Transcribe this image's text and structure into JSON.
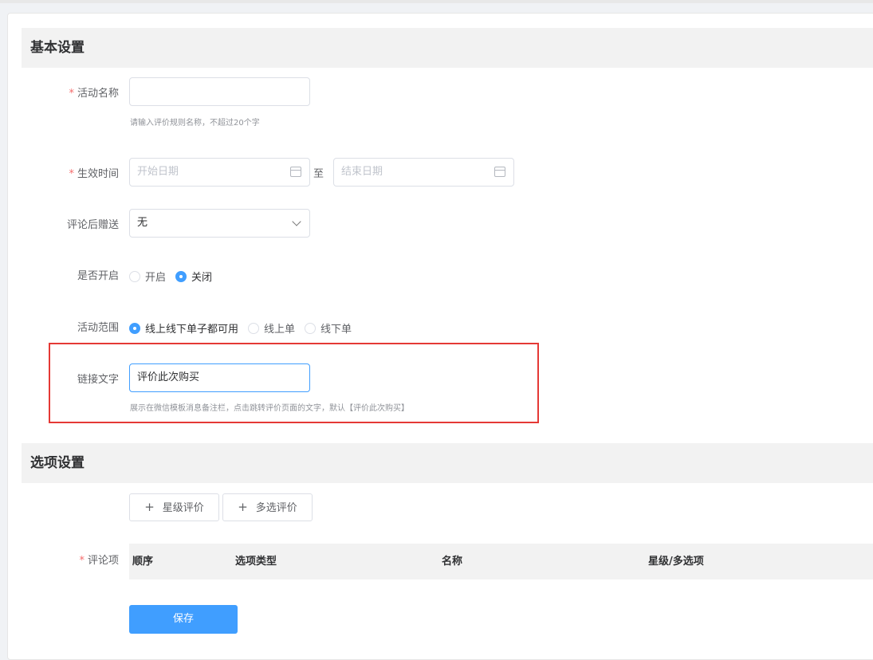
{
  "basic": {
    "section_title": "基本设置",
    "activity_name": {
      "label": "活动名称",
      "value": "",
      "hint": "请输入评价规则名称，不超过20个字"
    },
    "effective_time": {
      "label": "生效时间",
      "start_placeholder": "开始日期",
      "separator": "至",
      "end_placeholder": "结束日期"
    },
    "gift": {
      "label": "评论后赠送",
      "value": "无"
    },
    "enabled": {
      "label": "是否开启",
      "options": [
        "开启",
        "关闭"
      ],
      "selected": "关闭"
    },
    "scope": {
      "label": "活动范围",
      "options": [
        "线上线下单子都可用",
        "线上单",
        "线下单"
      ],
      "selected": "线上线下单子都可用"
    },
    "link_text": {
      "label": "链接文字",
      "value": "评价此次购买",
      "hint": "展示在微信模板消息备注栏，点击跳转评价页面的文字，默认【评价此次购买】"
    }
  },
  "options": {
    "section_title": "选项设置",
    "add_star_button": "星级评价",
    "add_multi_button": "多选评价",
    "review_items_label": "评论项",
    "table_columns": [
      "顺序",
      "选项类型",
      "名称",
      "星级/多选项"
    ]
  },
  "save_button": "保存",
  "colors": {
    "primary": "#409eff",
    "required": "#f56c6c",
    "highlight": "#e53935"
  }
}
